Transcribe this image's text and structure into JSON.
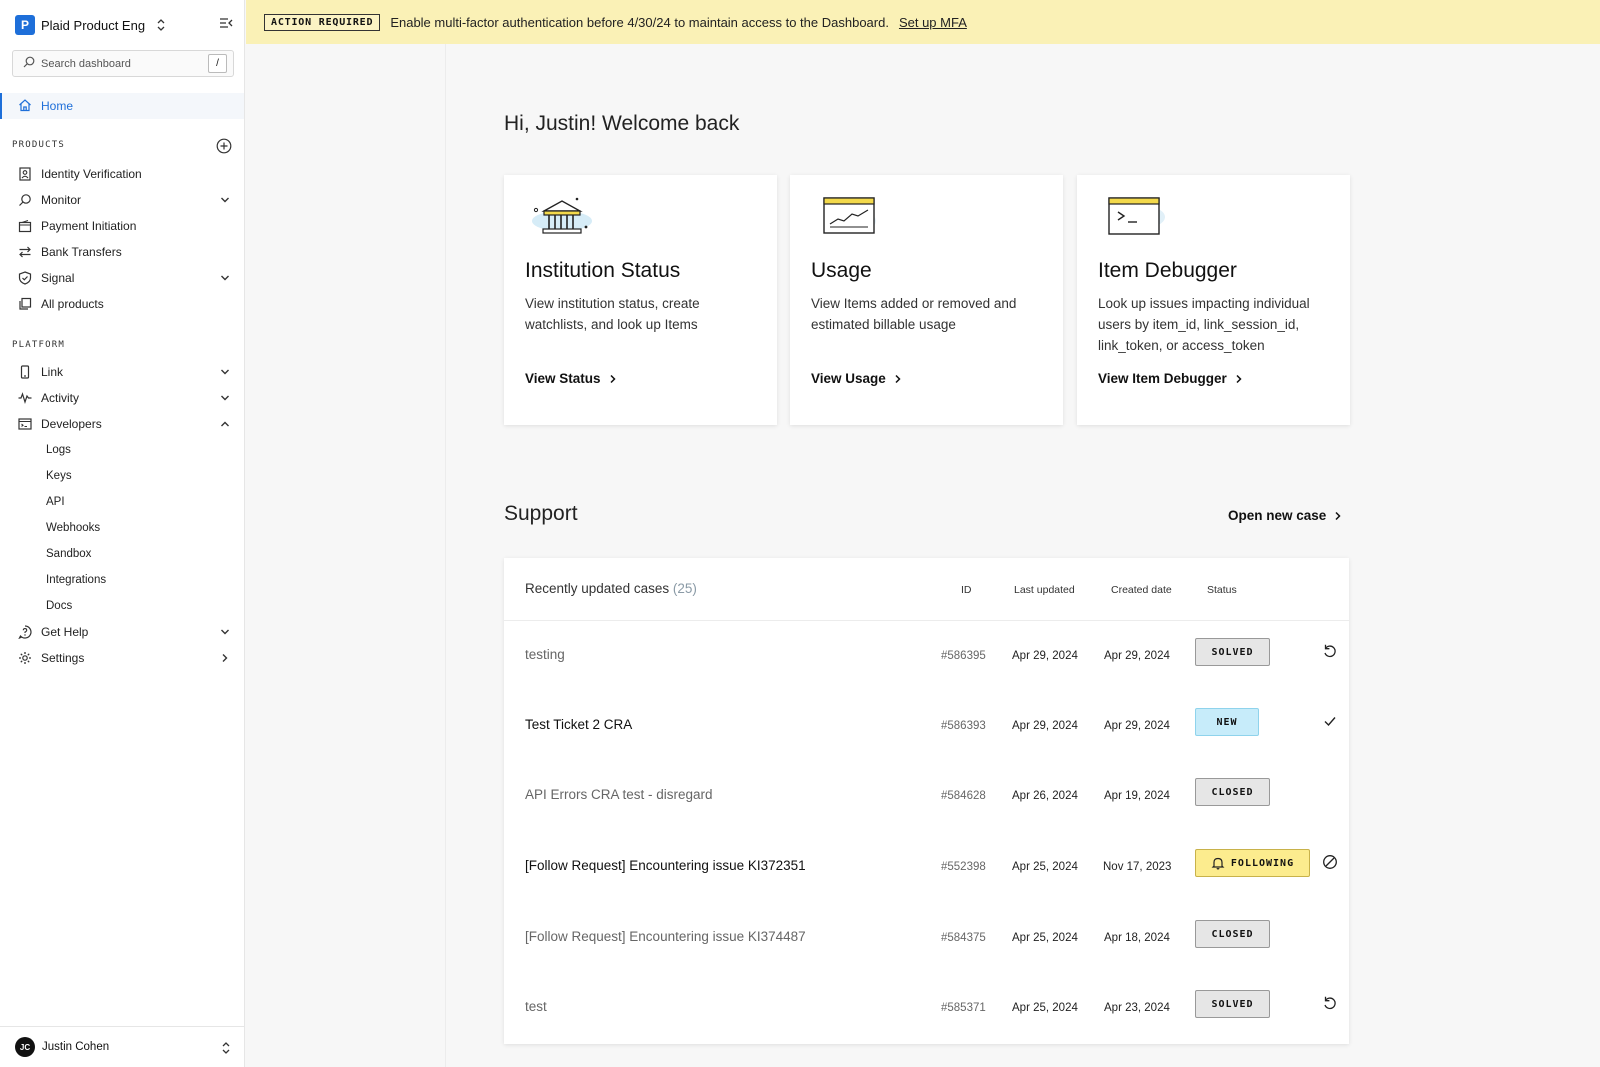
{
  "sidebar": {
    "workspace_initial": "P",
    "workspace_name": "Plaid Product Eng",
    "search_placeholder": "Search dashboard",
    "search_shortcut": "/",
    "home_label": "Home",
    "products_label": "PRODUCTS",
    "products": [
      {
        "label": "Identity Verification",
        "icon": "id-card-icon",
        "expandable": false
      },
      {
        "label": "Monitor",
        "icon": "search-icon",
        "expandable": true
      },
      {
        "label": "Payment Initiation",
        "icon": "wallet-icon",
        "expandable": false
      },
      {
        "label": "Bank Transfers",
        "icon": "transfer-icon",
        "expandable": false
      },
      {
        "label": "Signal",
        "icon": "shield-icon",
        "expandable": true
      },
      {
        "label": "All products",
        "icon": "stack-icon",
        "expandable": false
      }
    ],
    "platform_label": "PLATFORM",
    "platform": [
      {
        "label": "Link",
        "icon": "phone-icon"
      },
      {
        "label": "Activity",
        "icon": "pulse-icon"
      },
      {
        "label": "Developers",
        "icon": "terminal-window-icon"
      }
    ],
    "developer_items": [
      "Logs",
      "Keys",
      "API",
      "Webhooks",
      "Sandbox",
      "Integrations",
      "Docs"
    ],
    "help_label": "Get Help",
    "settings_label": "Settings",
    "user_initials": "JC",
    "user_name": "Justin Cohen"
  },
  "banner": {
    "tag": "ACTION REQUIRED",
    "message": "Enable multi-factor authentication before 4/30/24 to maintain access to the Dashboard.",
    "link": "Set up MFA",
    "color": "#faf1b6"
  },
  "main": {
    "greeting": "Hi, Justin! Welcome back",
    "cards": [
      {
        "title": "Institution Status",
        "description": "View institution status, create watchlists, and look up Items",
        "link": "View Status",
        "icon": "bank-building-icon"
      },
      {
        "title": "Usage",
        "description": "View Items added or removed and estimated billable usage",
        "link": "View Usage",
        "icon": "chart-window-icon"
      },
      {
        "title": "Item Debugger",
        "description": "Look up issues impacting individual users by item_id, link_session_id, link_token, or access_token",
        "link": "View Item Debugger",
        "icon": "terminal-icon"
      }
    ],
    "support": {
      "title": "Support",
      "open_case": "Open new case",
      "table_title": "Recently updated cases",
      "case_count": "(25)",
      "columns": [
        "ID",
        "Last updated",
        "Created date",
        "Status"
      ],
      "rows": [
        {
          "subject": "testing",
          "id": "#586395",
          "updated": "Apr 29, 2024",
          "created": "Apr 29, 2024",
          "status": "SOLVED",
          "action": "reopen-icon",
          "emphasis": "dim"
        },
        {
          "subject": "Test Ticket 2 CRA",
          "id": "#586393",
          "updated": "Apr 29, 2024",
          "created": "Apr 29, 2024",
          "status": "NEW",
          "action": "check-icon",
          "emphasis": "bold"
        },
        {
          "subject": "API Errors CRA test - disregard",
          "id": "#584628",
          "updated": "Apr 26, 2024",
          "created": "Apr 19, 2024",
          "status": "CLOSED",
          "action": "",
          "emphasis": "dim"
        },
        {
          "subject": "[Follow Request] Encountering issue KI372351",
          "id": "#552398",
          "updated": "Apr 25, 2024",
          "created": "Nov 17, 2023",
          "status": "FOLLOWING",
          "action": "unfollow-icon",
          "emphasis": "bold"
        },
        {
          "subject": "[Follow Request] Encountering issue KI374487",
          "id": "#584375",
          "updated": "Apr 25, 2024",
          "created": "Apr 18, 2024",
          "status": "CLOSED",
          "action": "",
          "emphasis": "dim"
        },
        {
          "subject": "test",
          "id": "#585371",
          "updated": "Apr 25, 2024",
          "created": "Apr 23, 2024",
          "status": "SOLVED",
          "action": "reopen-icon",
          "emphasis": "dim"
        }
      ]
    }
  },
  "colors": {
    "accent": "#1e6fd9",
    "new_badge": "#c7ecfa",
    "following_badge": "#fcec8e",
    "closed_badge": "#e6e6e6"
  }
}
